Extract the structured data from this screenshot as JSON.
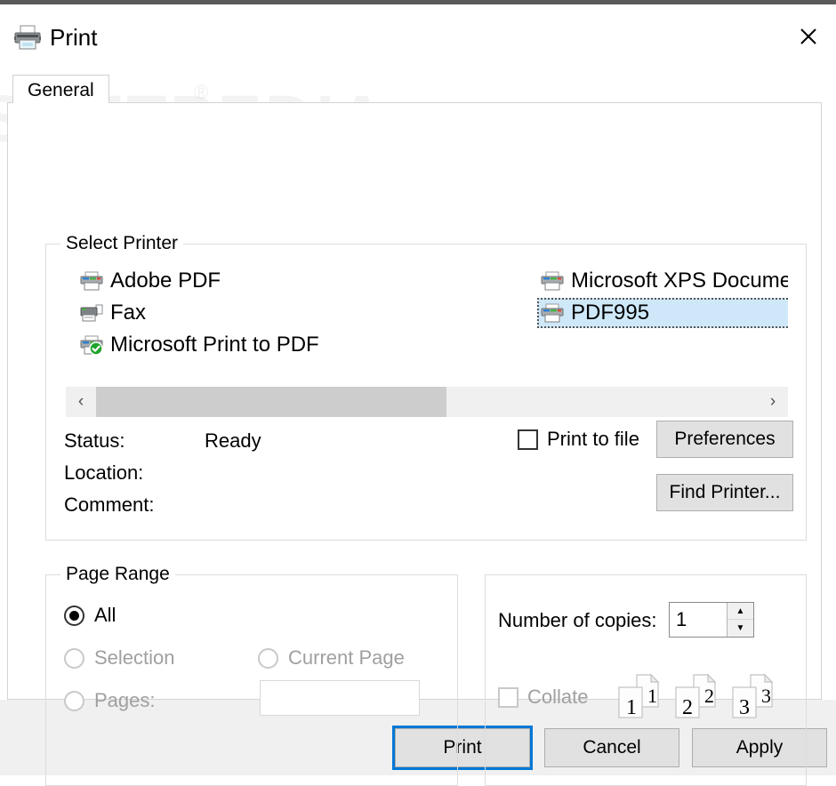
{
  "window": {
    "title": "Print",
    "title_icon": "printer-icon",
    "close_icon": "close-icon",
    "watermark": "SOFTPEDIA",
    "watermark_mark": "®"
  },
  "tabs": [
    {
      "label": "General",
      "selected": true
    }
  ],
  "select_printer": {
    "legend": "Select Printer",
    "printers": [
      {
        "name": "Adobe PDF",
        "icon": "printer-icon",
        "selected": false,
        "column": "a",
        "row": 0
      },
      {
        "name": "Fax",
        "icon": "fax-printer-icon",
        "selected": false,
        "column": "a",
        "row": 1
      },
      {
        "name": "Microsoft Print to PDF",
        "icon": "printer-default-icon",
        "selected": false,
        "column": "a",
        "row": 2
      },
      {
        "name": "Microsoft XPS Document Writer",
        "icon": "printer-icon",
        "selected": false,
        "column": "b",
        "row": 0
      },
      {
        "name": "PDF995",
        "icon": "printer-icon",
        "selected": true,
        "column": "b",
        "row": 1
      }
    ],
    "scrollbar": {
      "left_icon": "chevron-left-icon",
      "left_label": "‹",
      "right_icon": "chevron-right-icon",
      "right_label": "›",
      "thumb_percent": 53
    },
    "status_label": "Status:",
    "status_value": "Ready",
    "location_label": "Location:",
    "location_value": "",
    "comment_label": "Comment:",
    "comment_value": "",
    "print_to_file_label": "Print to file",
    "print_to_file_checked": false,
    "preferences_label": "Preferences",
    "find_printer_label": "Find Printer..."
  },
  "page_range": {
    "legend": "Page Range",
    "all_label": "All",
    "all_checked": true,
    "selection_label": "Selection",
    "selection_checked": false,
    "selection_disabled": true,
    "current_page_label": "Current Page",
    "current_page_checked": false,
    "current_page_disabled": true,
    "pages_label": "Pages:",
    "pages_checked": false,
    "pages_disabled": true,
    "pages_value": "",
    "pages_placeholder": ""
  },
  "copies": {
    "number_label": "Number of copies:",
    "number_value": "1",
    "spin_up_icon": "chevron-up-icon",
    "spin_up_label": "▲",
    "spin_down_icon": "chevron-down-icon",
    "spin_down_label": "▼",
    "collate_label": "Collate",
    "collate_checked": false,
    "collate_disabled": true,
    "collate_preview_pages": [
      "1",
      "2",
      "3"
    ]
  },
  "footer": {
    "print_label": "Print",
    "cancel_label": "Cancel",
    "apply_label": "Apply"
  },
  "colors": {
    "accent": "#0078d7",
    "selection_bg": "#cfe8f9",
    "button_face": "#e1e1e1",
    "dialog_bg": "#f0f0f0",
    "disabled_text": "#a0a0a0"
  }
}
